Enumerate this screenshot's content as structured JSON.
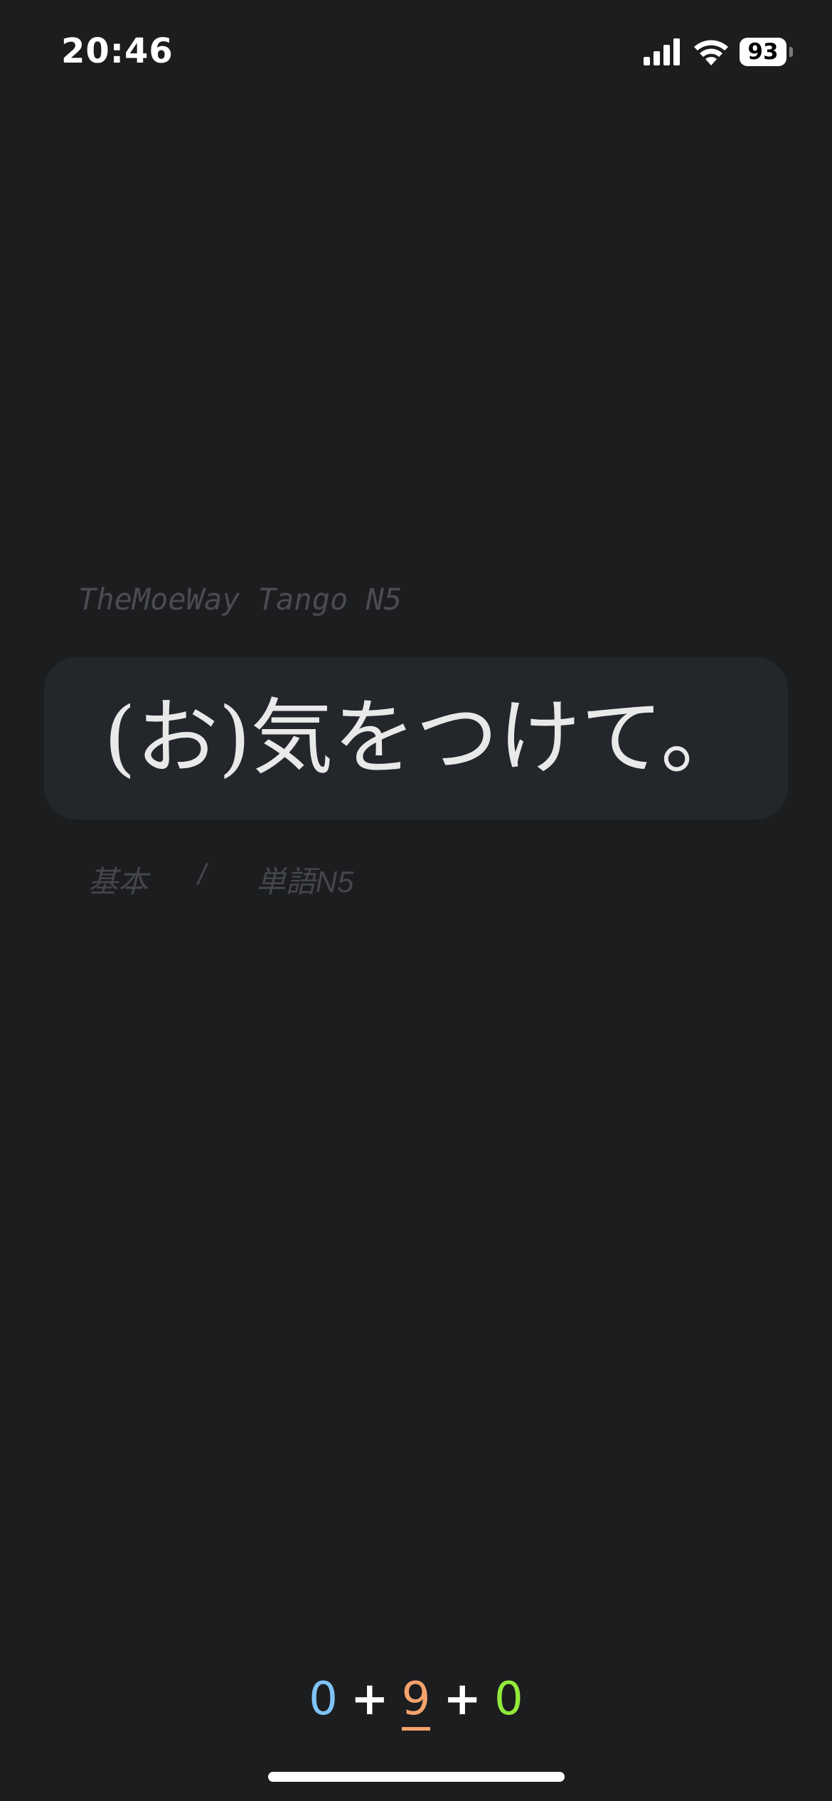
{
  "status_bar": {
    "time": "20:46",
    "battery_level": "93",
    "icons": [
      "signal-icon",
      "wifi-icon",
      "battery-icon"
    ]
  },
  "deck": {
    "title": "TheMoeWay Tango N5"
  },
  "card": {
    "front_text": "(お)気をつけて。"
  },
  "tags": {
    "tag1": "基本",
    "separator": "/",
    "tag2": "単語N5"
  },
  "counter": {
    "new": "0",
    "plus1": "+",
    "learning": "9",
    "plus2": "+",
    "review": "0"
  },
  "colors": {
    "background": "#1c1d1f",
    "card": "#23272b",
    "new": "#7ec3f6",
    "learning": "#f5a36c",
    "review": "#93ea3a"
  }
}
